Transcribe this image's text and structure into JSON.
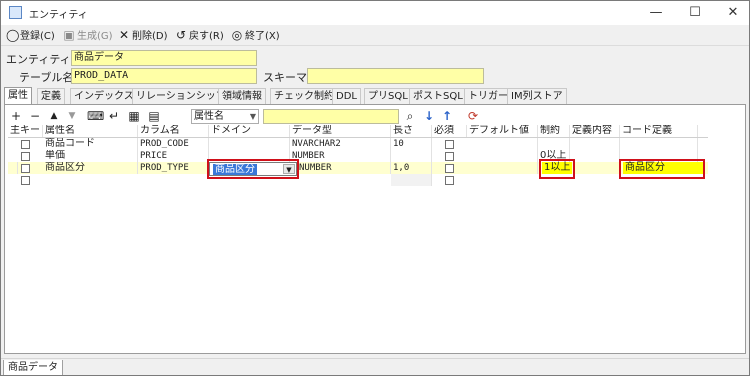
{
  "window": {
    "title": "エンティティ",
    "controls": {
      "minimize": "—",
      "maximize": "☐",
      "close": "✕"
    }
  },
  "toolbar": {
    "register": "登録(C)",
    "generate": "生成(G)",
    "delete": "削除(D)",
    "back": "戻す(R)",
    "exit": "終了(X)"
  },
  "form": {
    "entity_name_label": "エンティティ名",
    "entity_name_value": "商品データ",
    "table_name_label": "テーブル名",
    "table_name_value": "PROD_DATA",
    "schema_label": "スキーマ",
    "schema_value": ""
  },
  "tabs": [
    "属性",
    "定義",
    "インデックス",
    "リレーションシップ",
    "領域情報",
    "チェック制約",
    "DDL",
    "プリSQL",
    "ポストSQL",
    "トリガー",
    "IM列ストア"
  ],
  "grid_toolbar": {
    "field_select": "属性名",
    "search_value": ""
  },
  "grid": {
    "headers": [
      "主キー",
      "属性名",
      "カラム名",
      "ドメイン",
      "データ型",
      "長さ",
      "必須",
      "デフォルト値",
      "制約",
      "定義内容",
      "コード定義"
    ],
    "rows": [
      {
        "attr": "商品コード",
        "column": "PROD_CODE",
        "domain": "",
        "type": "NVARCHAR2",
        "length": "10",
        "default": "",
        "constraint": "",
        "definition": "",
        "code": ""
      },
      {
        "attr": "単価",
        "column": "PRICE",
        "domain": "",
        "type": "NUMBER",
        "length": "",
        "default": "",
        "constraint": "0以上",
        "definition": "",
        "code": ""
      },
      {
        "attr": "商品区分",
        "column": "PROD_TYPE",
        "domain": "商品区分",
        "type": "NUMBER",
        "length": "1,0",
        "default": "",
        "constraint": "1以上",
        "definition": "",
        "code": "商品区分"
      }
    ]
  },
  "status": {
    "tab": "商品データ"
  },
  "colors": {
    "highlight": "#ffffa6",
    "annotation": "#d0101a",
    "code_fill": "#ffff00"
  }
}
